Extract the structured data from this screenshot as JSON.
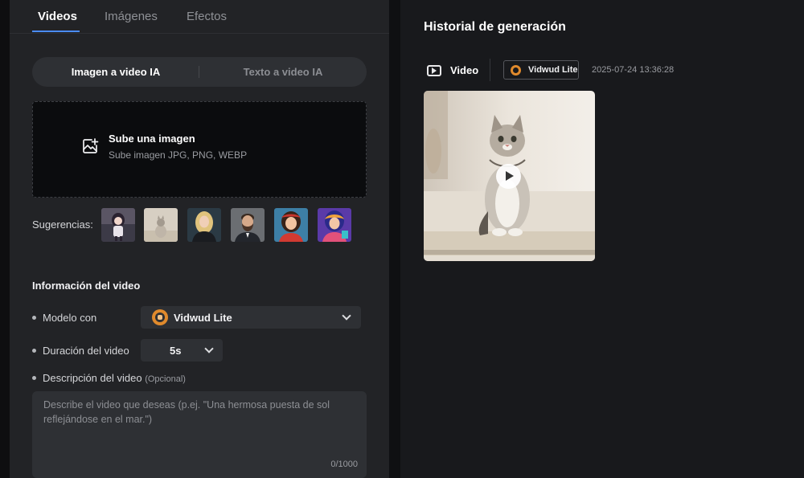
{
  "tabs": [
    {
      "label": "Videos",
      "active": true
    },
    {
      "label": "Imágenes",
      "active": false
    },
    {
      "label": "Efectos",
      "active": false
    }
  ],
  "mode_toggle": {
    "image_to_video": "Imagen a video IA",
    "text_to_video": "Texto a video IA",
    "selected": "image_to_video"
  },
  "upload": {
    "title": "Sube una imagen",
    "subtitle": "Sube imagen JPG, PNG, WEBP",
    "icon": "image-upload-icon"
  },
  "suggestions": {
    "label": "Sugerencias:",
    "items": [
      "anime-girl",
      "cat-on-rug",
      "blonde-woman",
      "bearded-man",
      "cartoon-woman",
      "colorful-character"
    ]
  },
  "video_info": {
    "title": "Información del video",
    "model_label": "Modelo con",
    "model_value": "Vidwud Lite",
    "duration_label": "Duración del video",
    "duration_value": "5s",
    "description_label": "Descripción del video",
    "description_optional": "(Opcional)",
    "description_placeholder": "Describe el video que deseas (p.ej. \"Una hermosa puesta de sol reflejándose en el mar.\")",
    "char_count": "0/1000"
  },
  "history": {
    "title": "Historial de generación",
    "item": {
      "type_label": "Video",
      "model": "Vidwud Lite",
      "timestamp": "2025-07-24 13:36:28"
    }
  },
  "colors": {
    "accent": "#4a8cff",
    "model_logo": "#e08a2c",
    "panel": "#222326",
    "input": "#2e3034"
  }
}
